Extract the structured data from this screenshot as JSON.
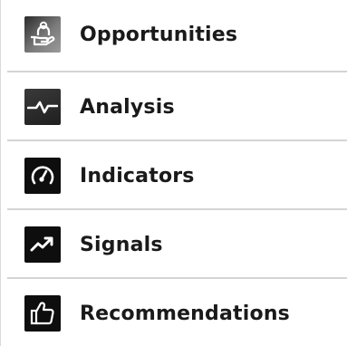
{
  "menu": {
    "items": [
      {
        "label": "Opportunities",
        "icon": "hand-with-person-icon"
      },
      {
        "label": "Analysis",
        "icon": "pulse-line-icon"
      },
      {
        "label": "Indicators",
        "icon": "speedometer-gauge-icon"
      },
      {
        "label": "Signals",
        "icon": "trending-up-arrow-icon"
      },
      {
        "label": "Recommendations",
        "icon": "thumbs-up-icon"
      }
    ]
  }
}
